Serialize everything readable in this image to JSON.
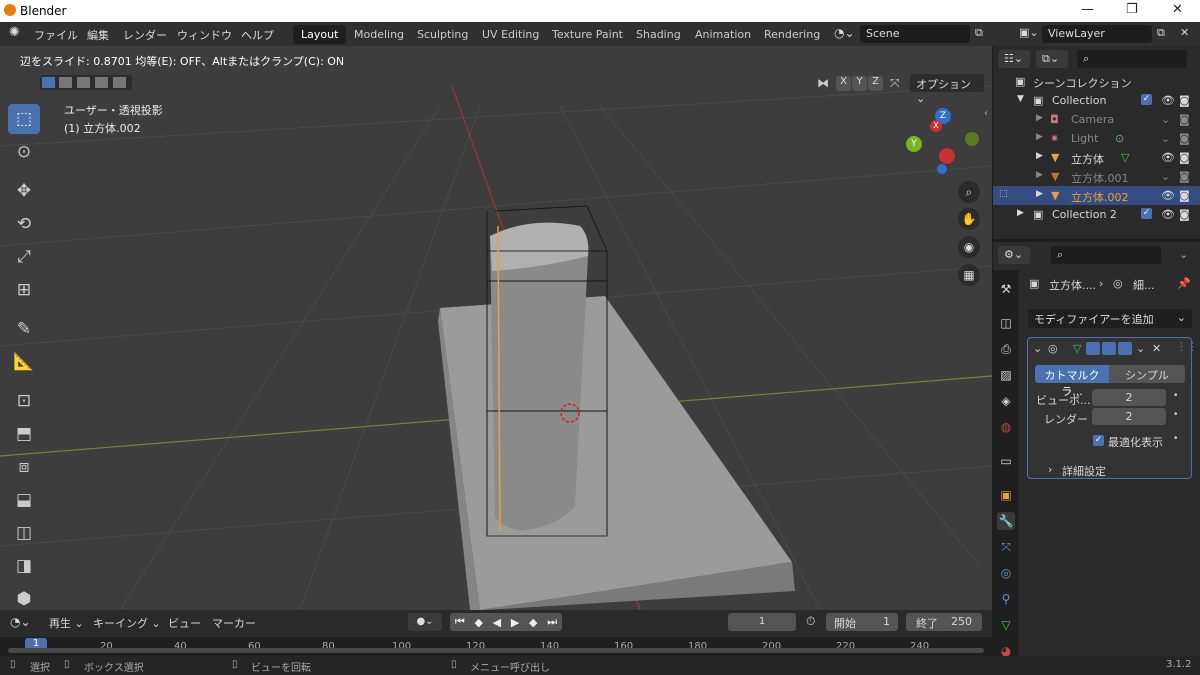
{
  "window": {
    "title": "Blender",
    "minimize": "—",
    "maximize": "❐",
    "close": "✕"
  },
  "menu": {
    "file": "ファイル",
    "edit": "編集",
    "render": "レンダー",
    "window": "ウィンドウ",
    "help": "ヘルプ"
  },
  "workspaces": [
    "Layout",
    "Modeling",
    "Sculpting",
    "UV Editing",
    "Texture Paint",
    "Shading",
    "Animation",
    "Rendering"
  ],
  "scene": {
    "name": "Scene",
    "view_layer": "ViewLayer"
  },
  "viewport": {
    "status": "辺をスライド: 0.8701 均等(E): OFF、Altまたはクランプ(C): ON",
    "projection": "ユーザー・透視投影",
    "object_info": "(1) 立方体.002",
    "axes": [
      "X",
      "Y",
      "Z"
    ],
    "options": "オプション",
    "gizmo": {
      "x": "X",
      "y": "Y",
      "z": "Z"
    }
  },
  "outliner": {
    "scene_collection": "シーンコレクション",
    "items": [
      {
        "name": "Collection",
        "depth": 1,
        "selected": false
      },
      {
        "name": "Camera",
        "depth": 2,
        "selected": false
      },
      {
        "name": "Light",
        "depth": 2,
        "selected": false
      },
      {
        "name": "立方体",
        "depth": 2,
        "selected": false
      },
      {
        "name": "立方体.001",
        "depth": 2,
        "selected": false
      },
      {
        "name": "立方体.002",
        "depth": 2,
        "selected": true
      },
      {
        "name": "Collection 2",
        "depth": 1,
        "selected": false
      }
    ]
  },
  "properties": {
    "breadcrumb_object": "立方体....",
    "breadcrumb_modifier": "細...",
    "add_modifier": "モディファイアーを追加",
    "subdiv": {
      "tab_catmull": "カトマルクラ...",
      "tab_simple": "シンプル",
      "viewport_label": "ビューポ...",
      "viewport_value": "2",
      "render_label": "レンダー",
      "render_value": "2",
      "optimal_display": "最適化表示",
      "advanced": "詳細設定"
    }
  },
  "timeline": {
    "playback": "再生",
    "keying": "キーイング",
    "view": "ビュー",
    "marker": "マーカー",
    "current_frame": "1",
    "start_label": "開始",
    "start_value": "1",
    "end_label": "終了",
    "end_value": "250",
    "ruler": [
      "1",
      "20",
      "40",
      "60",
      "80",
      "100",
      "120",
      "140",
      "160",
      "180",
      "200",
      "220",
      "240"
    ]
  },
  "statusbar": {
    "select": "選択",
    "box_select": "ボックス選択",
    "rotate_view": "ビューを回転",
    "call_menu": "メニュー呼び出し",
    "version": "3.1.2"
  },
  "colors": {
    "accent": "#4a72b0",
    "header": "#303030",
    "viewport": "#3d3d3d",
    "selected_orange": "#f29d39"
  }
}
